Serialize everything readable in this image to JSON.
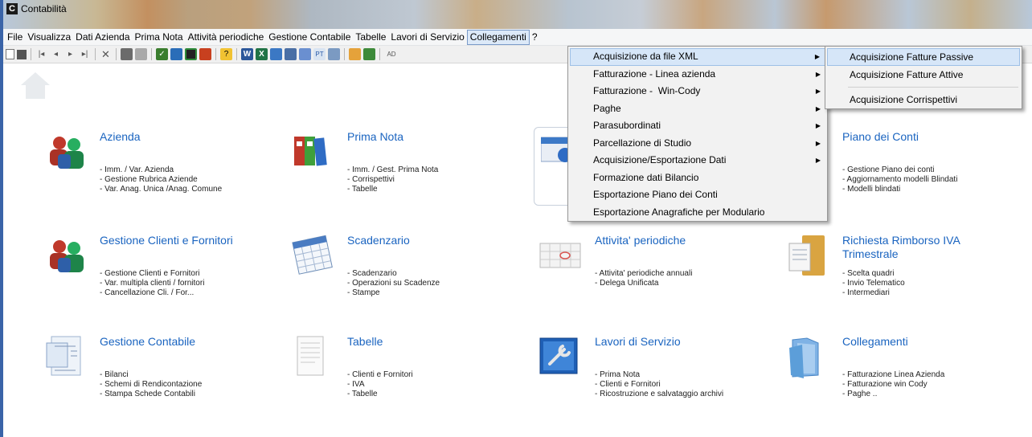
{
  "window": {
    "title": "Contabilità",
    "icon": "app-c-icon"
  },
  "menubar": {
    "items": [
      "File",
      "Visualizza",
      "Dati Azienda",
      "Prima Nota",
      "Attività periodiche",
      "Gestione Contabile",
      "Tabelle",
      "Lavori di Servizio",
      "Collegamenti",
      "?"
    ],
    "active_index": 8
  },
  "toolbar": {
    "icons": [
      "new-icon",
      "save-icon",
      "first-icon",
      "prev-icon",
      "next-icon",
      "last-icon",
      "delete-icon",
      "print-icon",
      "preview-icon",
      "check-icon",
      "wizard-icon",
      "calc-icon",
      "export-icon",
      "help-icon",
      "word-icon",
      "excel-icon",
      "web-icon",
      "mail-icon",
      "chart-icon",
      "pdf-icon",
      "printer-icon",
      "tools-icon",
      "search-icon",
      "ad-icon"
    ],
    "ad_label": "AD"
  },
  "dropdown": {
    "items": [
      {
        "label": "Acquisizione da file XML",
        "has_submenu": true,
        "highlighted": true
      },
      {
        "label": "Fatturazione - Linea azienda",
        "has_submenu": true
      },
      {
        "label": "Fatturazione -  Win-Cody",
        "has_submenu": true
      },
      {
        "label": "Paghe",
        "has_submenu": true
      },
      {
        "label": "Parasubordinati",
        "has_submenu": true
      },
      {
        "label": "Parcellazione di Studio",
        "has_submenu": true
      },
      {
        "label": "Acquisizione/Esportazione Dati",
        "has_submenu": true
      },
      {
        "label": "Formazione dati Bilancio",
        "has_submenu": false
      },
      {
        "label": "Esportazione Piano dei Conti",
        "has_submenu": false
      },
      {
        "label": "Esportazione Anagrafiche per Modulario",
        "has_submenu": false
      }
    ]
  },
  "submenu": {
    "items": [
      "Acquisizione Fatture Passive",
      "Acquisizione Fatture Attive",
      "Acquisizione Corrispettivi"
    ]
  },
  "tiles": [
    {
      "title": "Azienda",
      "lines": [
        "- Imm. / Var.  Azienda",
        "- Gestione Rubrica Aziende",
        "- Var. Anag. Unica /Anag. Comune"
      ],
      "icon": "users-icon"
    },
    {
      "title": "Prima Nota",
      "lines": [
        "- Imm. / Gest. Prima Nota",
        "- Corrispettivi",
        "- Tabelle"
      ],
      "icon": "binders-icon"
    },
    {
      "title": "",
      "lines": [],
      "icon": "calendar-gear-icon"
    },
    {
      "title": "Piano dei Conti",
      "lines": [
        "- Gestione Piano dei conti",
        "- Aggiornamento modelli Blindati",
        "- Modelli blindati"
      ],
      "icon": ""
    },
    {
      "title": "Gestione Clienti e Fornitori",
      "lines": [
        "- Gestione Clienti e Fornitori",
        "- Var. multipla clienti / fornitori",
        "- Cancellazione Cli. / For..."
      ],
      "icon": "users-icon"
    },
    {
      "title": "Scadenzario",
      "lines": [
        "- Scadenzario",
        "- Operazioni su Scadenze",
        "- Stampe"
      ],
      "icon": "calendar-icon"
    },
    {
      "title": "Attivita' periodiche",
      "lines": [
        "- Attivita' periodiche annuali",
        "- Delega Unificata"
      ],
      "icon": "schedule-icon"
    },
    {
      "title": "Richiesta Rimborso IVA Trimestrale",
      "title_lines": [
        "Richiesta Rimborso IVA",
        "Trimestrale"
      ],
      "lines": [
        "- Scelta quadri",
        "- Invio Telematico",
        "- Intermediari"
      ],
      "icon": "folder-docs-icon"
    },
    {
      "title": "Gestione Contabile",
      "lines": [
        "- Bilanci",
        "- Schemi di Rendicontazione",
        "- Stampa Schede Contabili"
      ],
      "icon": "documents-icon"
    },
    {
      "title": "Tabelle",
      "lines": [
        "- Clienti e Fornitori",
        "- IVA",
        "- Tabelle"
      ],
      "icon": "document-icon"
    },
    {
      "title": "Lavori di Servizio",
      "lines": [
        "- Prima Nota",
        "- Clienti e Fornitori",
        "- Ricostruzione e salvataggio archivi"
      ],
      "icon": "wrench-icon"
    },
    {
      "title": "Collegamenti",
      "lines": [
        "- Fatturazione Linea Azienda",
        "- Fatturazione win Cody",
        "- Paghe .."
      ],
      "icon": "folder-blue-icon"
    }
  ],
  "colors": {
    "tile_title": "#1a64c0",
    "menu_highlight": "#d6e6f8",
    "window_border": "#3a64a8"
  }
}
